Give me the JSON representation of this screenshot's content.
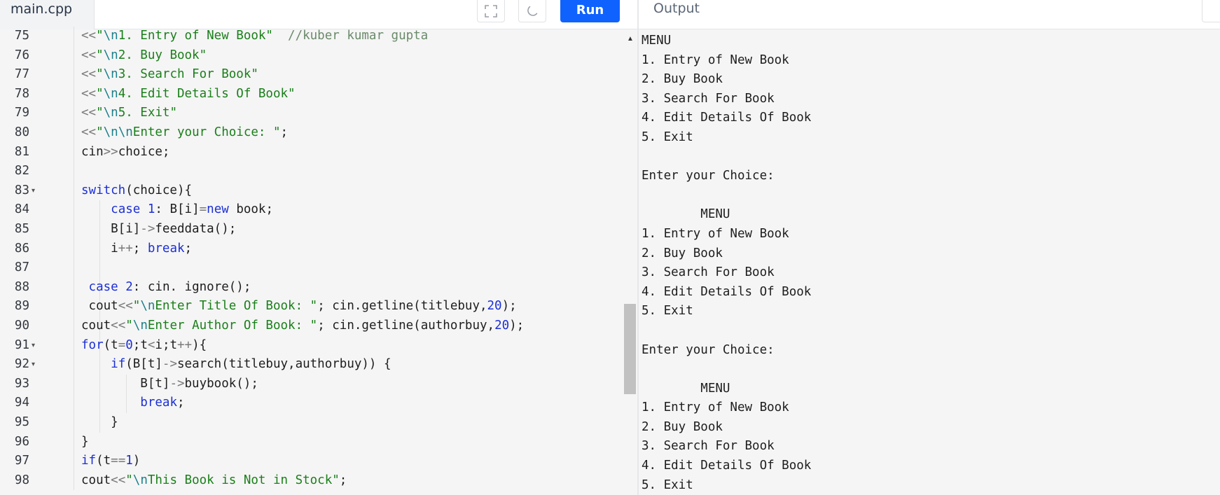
{
  "header": {
    "file_tab": "main.cpp",
    "run_label": "Run",
    "output_title": "Output"
  },
  "icons": {
    "fullscreen": "fullscreen-icon",
    "theme": "moon-icon"
  },
  "colors": {
    "run_button": "#0f62fe",
    "string": "#1a7f1a",
    "keyword": "#1c2fd6",
    "comment": "#6a8a6a"
  },
  "editor": {
    "line_numbers": [
      "75",
      "76",
      "77",
      "78",
      "79",
      "80",
      "81",
      "82",
      "83",
      "84",
      "85",
      "86",
      "87",
      "88",
      "89",
      "90",
      "91",
      "92",
      "93",
      "94",
      "95",
      "96",
      "97",
      "98"
    ],
    "folded_lines": [
      "83",
      "91",
      "92"
    ],
    "lines": [
      [
        {
          "t": "<<",
          "c": "op"
        },
        {
          "t": "\"",
          "c": "str"
        },
        {
          "t": "\\n",
          "c": "esc"
        },
        {
          "t": "1. Entry of New Book\"",
          "c": "str"
        },
        {
          "t": "  //kuber kumar gupta",
          "c": "cmt"
        }
      ],
      [
        {
          "t": "<<",
          "c": "op"
        },
        {
          "t": "\"",
          "c": "str"
        },
        {
          "t": "\\n",
          "c": "esc"
        },
        {
          "t": "2. Buy Book\"",
          "c": "str"
        }
      ],
      [
        {
          "t": "<<",
          "c": "op"
        },
        {
          "t": "\"",
          "c": "str"
        },
        {
          "t": "\\n",
          "c": "esc"
        },
        {
          "t": "3. Search For Book\"",
          "c": "str"
        }
      ],
      [
        {
          "t": "<<",
          "c": "op"
        },
        {
          "t": "\"",
          "c": "str"
        },
        {
          "t": "\\n",
          "c": "esc"
        },
        {
          "t": "4. Edit Details Of Book\"",
          "c": "str"
        }
      ],
      [
        {
          "t": "<<",
          "c": "op"
        },
        {
          "t": "\"",
          "c": "str"
        },
        {
          "t": "\\n",
          "c": "esc"
        },
        {
          "t": "5. Exit\"",
          "c": "str"
        }
      ],
      [
        {
          "t": "<<",
          "c": "op"
        },
        {
          "t": "\"",
          "c": "str"
        },
        {
          "t": "\\n\\n",
          "c": "esc"
        },
        {
          "t": "Enter your Choice: \"",
          "c": "str"
        },
        {
          "t": ";",
          "c": ""
        }
      ],
      [
        {
          "t": "cin",
          "c": ""
        },
        {
          "t": ">>",
          "c": "op"
        },
        {
          "t": "choice;",
          "c": ""
        }
      ],
      [],
      [
        {
          "t": "switch",
          "c": "kw"
        },
        {
          "t": "(choice){",
          "c": ""
        }
      ],
      [
        {
          "t": "    ",
          "c": ""
        },
        {
          "t": "case",
          "c": "kw"
        },
        {
          "t": " ",
          "c": ""
        },
        {
          "t": "1",
          "c": "num"
        },
        {
          "t": ": B[i]",
          "c": ""
        },
        {
          "t": "=",
          "c": "op"
        },
        {
          "t": "new",
          "c": "kw"
        },
        {
          "t": " book;",
          "c": ""
        }
      ],
      [
        {
          "t": "    B[i]",
          "c": ""
        },
        {
          "t": "->",
          "c": "op"
        },
        {
          "t": "feeddata();",
          "c": ""
        }
      ],
      [
        {
          "t": "    i",
          "c": ""
        },
        {
          "t": "++",
          "c": "op"
        },
        {
          "t": "; ",
          "c": ""
        },
        {
          "t": "break",
          "c": "kw"
        },
        {
          "t": ";",
          "c": ""
        }
      ],
      [],
      [
        {
          "t": " ",
          "c": ""
        },
        {
          "t": "case",
          "c": "kw"
        },
        {
          "t": " ",
          "c": ""
        },
        {
          "t": "2",
          "c": "num"
        },
        {
          "t": ": cin. ignore();",
          "c": ""
        }
      ],
      [
        {
          "t": " cout",
          "c": ""
        },
        {
          "t": "<<",
          "c": "op"
        },
        {
          "t": "\"",
          "c": "str"
        },
        {
          "t": "\\n",
          "c": "esc"
        },
        {
          "t": "Enter Title Of Book: \"",
          "c": "str"
        },
        {
          "t": "; cin.getline(titlebuy,",
          "c": ""
        },
        {
          "t": "20",
          "c": "num"
        },
        {
          "t": ");",
          "c": ""
        }
      ],
      [
        {
          "t": "cout",
          "c": ""
        },
        {
          "t": "<<",
          "c": "op"
        },
        {
          "t": "\"",
          "c": "str"
        },
        {
          "t": "\\n",
          "c": "esc"
        },
        {
          "t": "Enter Author Of Book: \"",
          "c": "str"
        },
        {
          "t": "; cin.getline(authorbuy,",
          "c": ""
        },
        {
          "t": "20",
          "c": "num"
        },
        {
          "t": ");",
          "c": ""
        }
      ],
      [
        {
          "t": "for",
          "c": "kw"
        },
        {
          "t": "(t",
          "c": ""
        },
        {
          "t": "=",
          "c": "op"
        },
        {
          "t": "0",
          "c": "num"
        },
        {
          "t": ";t",
          "c": ""
        },
        {
          "t": "<",
          "c": "op"
        },
        {
          "t": "i;t",
          "c": ""
        },
        {
          "t": "++",
          "c": "op"
        },
        {
          "t": "){",
          "c": ""
        }
      ],
      [
        {
          "t": "    ",
          "c": ""
        },
        {
          "t": "if",
          "c": "kw"
        },
        {
          "t": "(B[t]",
          "c": ""
        },
        {
          "t": "->",
          "c": "op"
        },
        {
          "t": "search(titlebuy,authorbuy)) {",
          "c": ""
        }
      ],
      [
        {
          "t": "        B[t]",
          "c": ""
        },
        {
          "t": "->",
          "c": "op"
        },
        {
          "t": "buybook();",
          "c": ""
        }
      ],
      [
        {
          "t": "        ",
          "c": ""
        },
        {
          "t": "break",
          "c": "kw"
        },
        {
          "t": ";",
          "c": ""
        }
      ],
      [
        {
          "t": "    }",
          "c": ""
        }
      ],
      [
        {
          "t": "}",
          "c": ""
        }
      ],
      [
        {
          "t": "if",
          "c": "kw"
        },
        {
          "t": "(t",
          "c": ""
        },
        {
          "t": "==",
          "c": "op"
        },
        {
          "t": "1",
          "c": "num"
        },
        {
          "t": ")",
          "c": ""
        }
      ],
      [
        {
          "t": "cout",
          "c": ""
        },
        {
          "t": "<<",
          "c": "op"
        },
        {
          "t": "\"",
          "c": "str"
        },
        {
          "t": "\\n",
          "c": "esc"
        },
        {
          "t": "This Book is Not in Stock\"",
          "c": "str"
        },
        {
          "t": ";",
          "c": ""
        }
      ]
    ]
  },
  "output": {
    "text": "MENU\n1. Entry of New Book\n2. Buy Book\n3. Search For Book\n4. Edit Details Of Book\n5. Exit\n\nEnter your Choice: \n\n        MENU\n1. Entry of New Book\n2. Buy Book\n3. Search For Book\n4. Edit Details Of Book\n5. Exit\n\nEnter your Choice: \n\n        MENU\n1. Entry of New Book\n2. Buy Book\n3. Search For Book\n4. Edit Details Of Book\n5. Exit"
  }
}
